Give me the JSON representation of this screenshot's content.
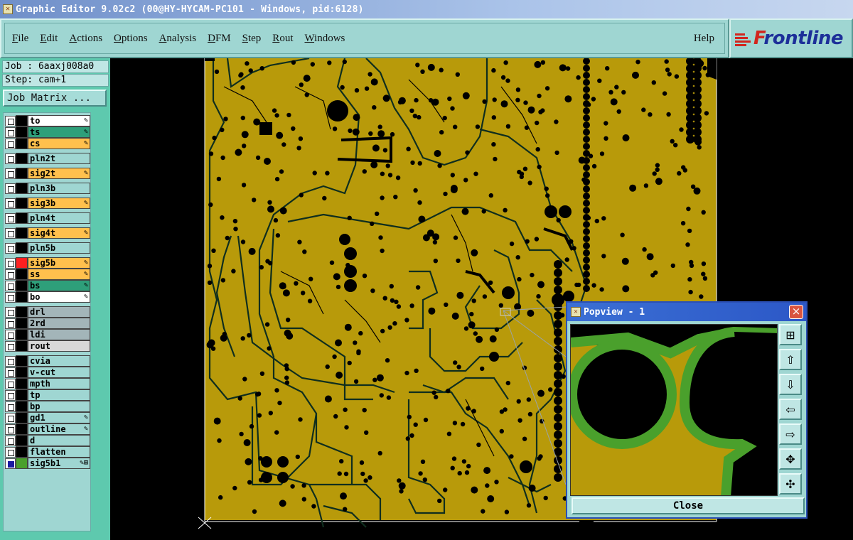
{
  "window": {
    "title": "Graphic Editor 9.02c2 (00@HY-HYCAM-PC101 - Windows, pid:6128)"
  },
  "menu": {
    "items": [
      "File",
      "Edit",
      "Actions",
      "Options",
      "Analysis",
      "DFM",
      "Step",
      "Rout",
      "Windows"
    ],
    "help": "Help"
  },
  "logo": {
    "text_accent": "F",
    "text_rest": "rontline"
  },
  "job": {
    "label": "Job : 6aaxj008a0",
    "step": "Step: cam+1"
  },
  "job_matrix": "Job Matrix ...",
  "layers": [
    {
      "name": "to",
      "color": "#000000",
      "bg": "#ffffff",
      "pin": "✎"
    },
    {
      "name": "ts",
      "color": "#000000",
      "bg": "#2e9f7a",
      "pin": "✎"
    },
    {
      "name": "cs",
      "color": "#000000",
      "bg": "#ffc04d",
      "pin": "✎"
    },
    {
      "name": "pln2t",
      "color": "#000000",
      "bg": "#9fd6d2",
      "pin": ""
    },
    {
      "name": "sig2t",
      "color": "#000000",
      "bg": "#ffc04d",
      "pin": "✎"
    },
    {
      "name": "pln3b",
      "color": "#000000",
      "bg": "#9fd6d2",
      "pin": ""
    },
    {
      "name": "sig3b",
      "color": "#000000",
      "bg": "#ffc04d",
      "pin": "✎"
    },
    {
      "name": "pln4t",
      "color": "#000000",
      "bg": "#9fd6d2",
      "pin": ""
    },
    {
      "name": "sig4t",
      "color": "#000000",
      "bg": "#ffc04d",
      "pin": "✎"
    },
    {
      "name": "pln5b",
      "color": "#000000",
      "bg": "#9fd6d2",
      "pin": ""
    },
    {
      "name": "sig5b",
      "color": "#ff2020",
      "bg": "#ffc04d",
      "pin": "✎"
    },
    {
      "name": "ss",
      "color": "#000000",
      "bg": "#ffc04d",
      "pin": "✎"
    },
    {
      "name": "bs",
      "color": "#000000",
      "bg": "#2e9f7a",
      "pin": "✎"
    },
    {
      "name": "bo",
      "color": "#000000",
      "bg": "#ffffff",
      "pin": "✎"
    },
    {
      "name": "drl",
      "color": "#000000",
      "bg": "#a3b5b9",
      "pin": ""
    },
    {
      "name": "2rd",
      "color": "#000000",
      "bg": "#a3b5b9",
      "pin": ""
    },
    {
      "name": "ldi",
      "color": "#000000",
      "bg": "#a3b5b9",
      "pin": ""
    },
    {
      "name": "rout",
      "color": "#000000",
      "bg": "#d8d8d8",
      "pin": ""
    },
    {
      "name": "cvia",
      "color": "#000000",
      "bg": "#9fd6d2",
      "pin": ""
    },
    {
      "name": "v-cut",
      "color": "#000000",
      "bg": "#9fd6d2",
      "pin": ""
    },
    {
      "name": "mpth",
      "color": "#000000",
      "bg": "#9fd6d2",
      "pin": ""
    },
    {
      "name": "tp",
      "color": "#000000",
      "bg": "#9fd6d2",
      "pin": ""
    },
    {
      "name": "bp",
      "color": "#000000",
      "bg": "#9fd6d2",
      "pin": ""
    },
    {
      "name": "gd1",
      "color": "#000000",
      "bg": "#9fd6d2",
      "pin": "✎"
    },
    {
      "name": "outline",
      "color": "#000000",
      "bg": "#9fd6d2",
      "pin": "✎"
    },
    {
      "name": "d",
      "color": "#000000",
      "bg": "#9fd6d2",
      "pin": ""
    },
    {
      "name": "flatten",
      "color": "#000000",
      "bg": "#9fd6d2",
      "pin": ""
    },
    {
      "name": "sig5b1",
      "color": "#4aa02c",
      "bg": "#9fd6d2",
      "pin": "✎⊞",
      "checked": true
    }
  ],
  "colors": {
    "copper": "#b89a0a",
    "trace_outline": "#1b4a2e",
    "highlight_green": "#4aa02c"
  },
  "popview": {
    "title": "Popview - 1",
    "close_label": "Close",
    "tools": [
      "zoom-home-icon",
      "pan-up-icon",
      "pan-down-icon",
      "pan-left-icon",
      "pan-right-icon",
      "zoom-in-icon",
      "zoom-out-icon"
    ]
  }
}
